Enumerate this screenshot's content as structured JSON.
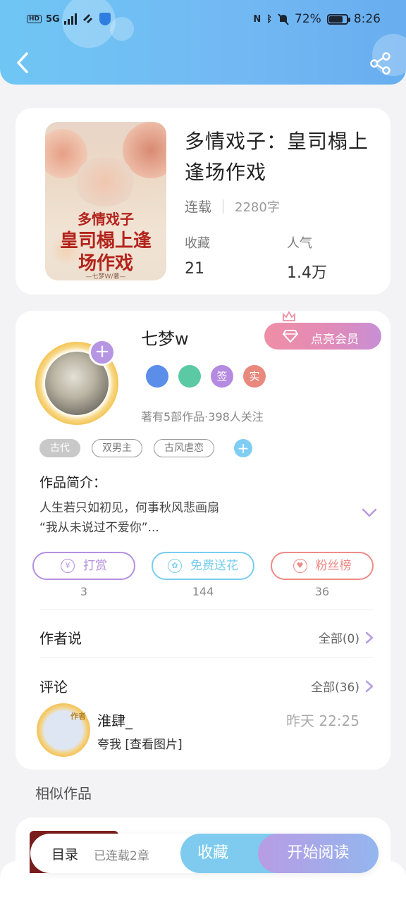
{
  "status_bar": {
    "hd": "HD",
    "network": "5G",
    "battery_text": "72%",
    "battery_level": 0.72,
    "time": "8:26"
  },
  "book": {
    "title": "多情戏子：皇司榻上逢场作戏",
    "status": "连载",
    "words": "2280字",
    "fav_label": "收藏",
    "fav_value": "21",
    "pop_label": "人气",
    "pop_value": "1.4万",
    "cover_title_top": "多情戏子",
    "cover_title_mid": "皇司榻上逢",
    "cover_title_bot": "场作戏",
    "cover_author": "—七梦W/著—"
  },
  "author": {
    "name": "七梦w",
    "vip_label": "点亮会员",
    "badges": [
      {
        "text": "",
        "color": "#5a8ee8"
      },
      {
        "text": "",
        "color": "#5cc9a5"
      },
      {
        "text": "签",
        "color": "#b48be0"
      },
      {
        "text": "实",
        "color": "#e9887d"
      }
    ],
    "sub": "著有5部作品·398人关注"
  },
  "tags": [
    "古代",
    "双男主",
    "古风虐恋"
  ],
  "intro": {
    "label": "作品简介：",
    "line1": "人生若只如初见，何事秋风悲画扇",
    "line2": "“我从未说过不爱你”..."
  },
  "actions": [
    {
      "label": "打赏",
      "count": "3",
      "color": "#b58fe0",
      "icon": "¥"
    },
    {
      "label": "免费送花",
      "count": "144",
      "color": "#79cdee",
      "icon": "✿"
    },
    {
      "label": "粉丝榜",
      "count": "36",
      "color": "#ee8b87",
      "icon": "♥"
    }
  ],
  "author_say": {
    "title": "作者说",
    "more": "全部(0)"
  },
  "comments": {
    "title": "评论",
    "more": "全部(36)",
    "item": {
      "name": "淮肆_",
      "time": "昨天 22:25",
      "text": "夸我  [查看图片]",
      "badge": "作者"
    }
  },
  "similar": {
    "title": "相似作品"
  },
  "bottom_bar": {
    "toc": "目录",
    "progress": "已连载2章",
    "fav": "收藏",
    "read": "开始阅读"
  }
}
